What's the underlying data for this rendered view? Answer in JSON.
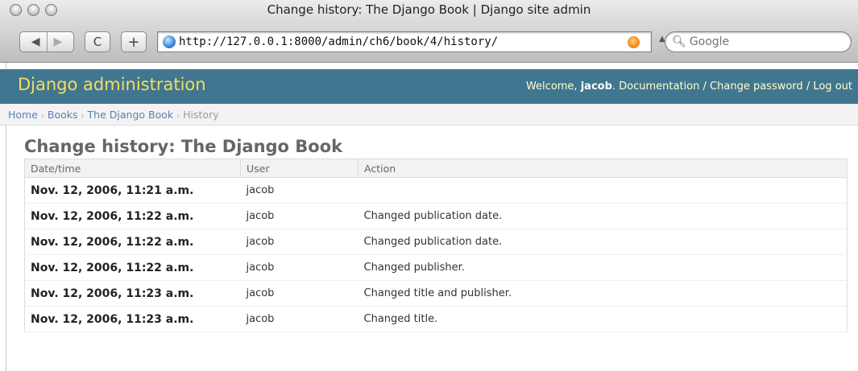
{
  "window": {
    "title": "Change history: The Django Book | Django site admin"
  },
  "toolbar": {
    "back_label": "◀",
    "forward_label": "▶",
    "reload_label": "C",
    "newtab_label": "+",
    "url": "http://127.0.0.1:8000/admin/ch6/book/4/history/",
    "search_placeholder": "Google"
  },
  "header": {
    "branding": "Django administration",
    "welcome": "Welcome,",
    "user": "jacob",
    "links": [
      "Documentation",
      "Change password",
      "Log out"
    ],
    "link_separator": "/",
    "bg_color": "#417690",
    "brand_color": "#f5dd5d"
  },
  "breadcrumbs": [
    "Home",
    "Books",
    "The Django Book",
    "History"
  ],
  "main": {
    "title": "Change history: The Django Book",
    "columns": [
      "Date/time",
      "User",
      "Action"
    ],
    "rows": [
      {
        "date": "Nov. 12, 2006, 11:21 a.m.",
        "user": "jacob",
        "action": ""
      },
      {
        "date": "Nov. 12, 2006, 11:22 a.m.",
        "user": "jacob",
        "action": "Changed publication date."
      },
      {
        "date": "Nov. 12, 2006, 11:22 a.m.",
        "user": "jacob",
        "action": "Changed publication date."
      },
      {
        "date": "Nov. 12, 2006, 11:22 a.m.",
        "user": "jacob",
        "action": "Changed publisher."
      },
      {
        "date": "Nov. 12, 2006, 11:23 a.m.",
        "user": "jacob",
        "action": "Changed title and publisher."
      },
      {
        "date": "Nov. 12, 2006, 11:23 a.m.",
        "user": "jacob",
        "action": "Changed title."
      }
    ]
  }
}
